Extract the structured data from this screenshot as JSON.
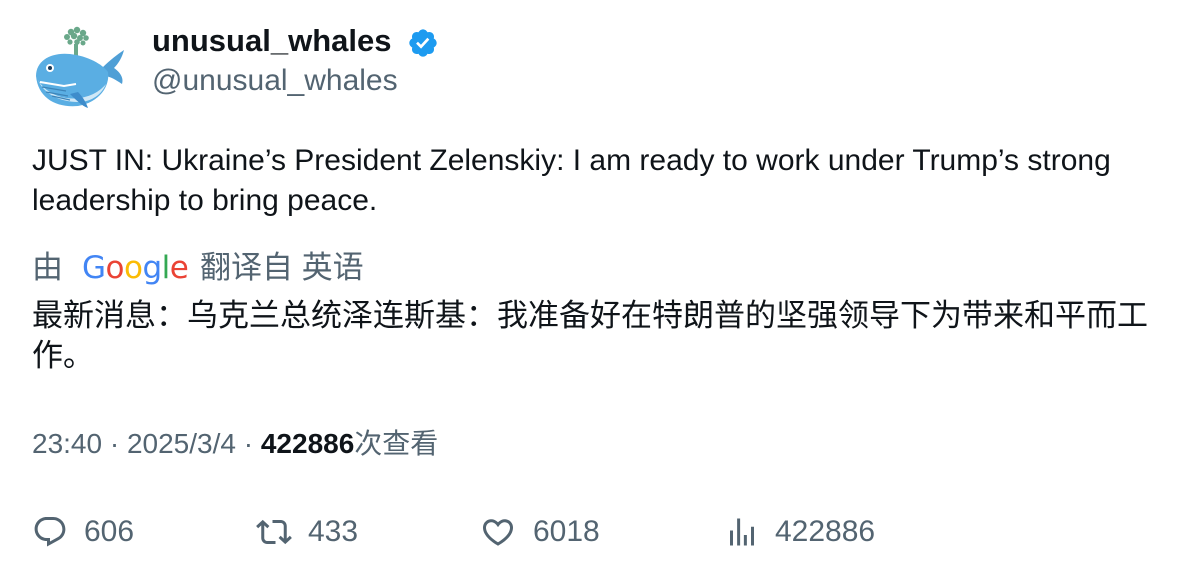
{
  "author": {
    "display_name": "unusual_whales",
    "handle": "@unusual_whales",
    "verified": true,
    "avatar_icon": "whale-avatar-icon"
  },
  "tweet": {
    "text": "JUST IN: Ukraine’s President Zelenskiy: I am ready to work under Trump’s strong leadership to bring peace."
  },
  "translation": {
    "by_label": "由",
    "provider": "Google",
    "from_label": "翻译自 英语",
    "text": "最新消息：乌克兰总统泽连斯基：我准备好在特朗普的坚强领导下为带来和平而工作。"
  },
  "meta": {
    "time": "23:40",
    "separator": "·",
    "date": "2025/3/4",
    "views_count": "422886",
    "views_label": "次查看"
  },
  "actions": {
    "replies": "606",
    "retweets": "433",
    "likes": "6018",
    "views": "422886"
  },
  "colors": {
    "verified": "#1d9bf0",
    "muted": "#536471",
    "text": "#0f1419",
    "google_blue": "#4285f4",
    "google_red": "#ea4335",
    "google_yellow": "#fbbc05",
    "google_green": "#34a853"
  }
}
